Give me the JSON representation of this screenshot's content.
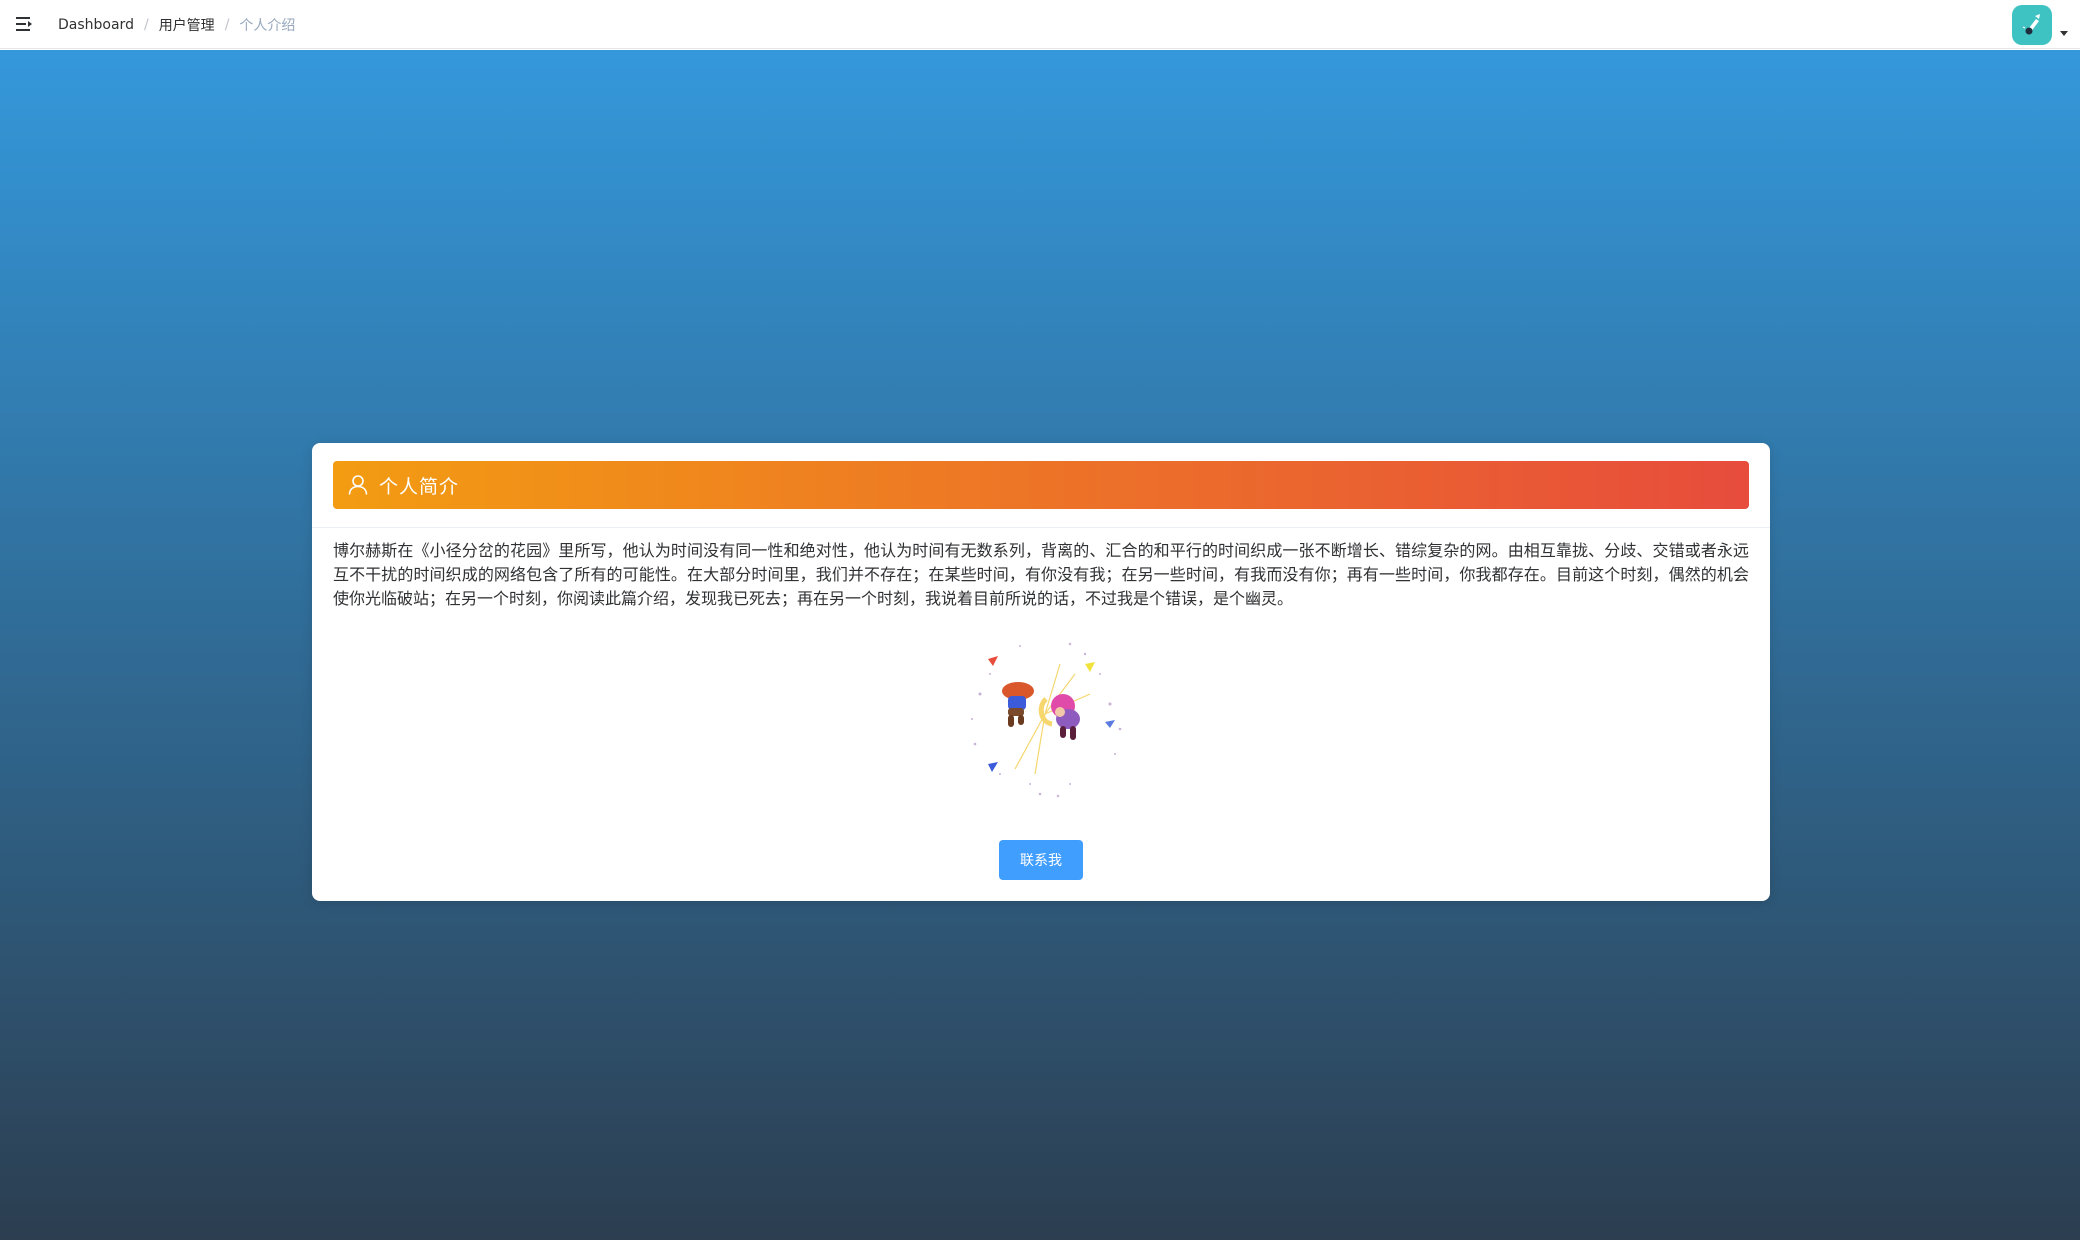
{
  "breadcrumb": {
    "items": [
      "Dashboard",
      "用户管理"
    ],
    "current": "个人介绍",
    "separator": "/"
  },
  "card": {
    "title": "个人简介",
    "body": "博尔赫斯在《小径分岔的花园》里所写，他认为时间没有同一性和绝对性，他认为时间有无数系列，背离的、汇合的和平行的时间织成一张不断增长、错综复杂的网。由相互靠拢、分歧、交错或者永远互不干扰的时间织成的网络包含了所有的可能性。在大部分时间里，我们并不存在；在某些时间，有你没有我；在另一些时间，有我而没有你；再有一些时间，你我都存在。目前这个时刻，偶然的机会使你光临破站；在另一个时刻，你阅读此篇介绍，发现我已死去；再在另一个时刻，我说着目前所说的话，不过我是个错误，是个幽灵。",
    "button_label": "联系我"
  },
  "colors": {
    "background_top": "#3498db",
    "background_bottom": "#2c3e50",
    "header_gradient_start": "#f39c12",
    "header_gradient_end": "#e74c3c",
    "button": "#409eff",
    "avatar": "#3fc2c2"
  },
  "icons": {
    "sidebar_toggle": "hamburger-icon",
    "card_header": "user-icon",
    "avatar_menu": "caret-down-icon"
  }
}
